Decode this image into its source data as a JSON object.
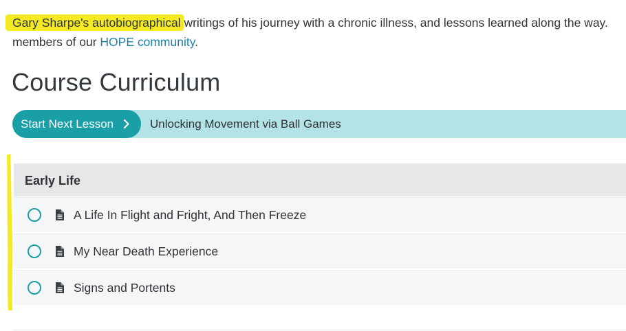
{
  "intro": {
    "highlighted_text": "Gary Sharpe's autobiographical",
    "line1_rest": " writings of his journey with a chronic illness, and lessons learned along the way.",
    "line2_prefix": "members of our ",
    "community_link": "HOPE community",
    "line2_suffix": "."
  },
  "curriculum": {
    "heading": "Course Curriculum",
    "next_lesson_button": "Start Next Lesson",
    "next_lesson_title": "Unlocking Movement via Ball Games"
  },
  "sections": [
    {
      "title": "Early Life",
      "lessons": [
        {
          "title": "A Life In Flight and Fright, And Then Freeze",
          "icon": "document-icon",
          "status": "incomplete"
        },
        {
          "title": "My Near Death Experience",
          "icon": "document-icon",
          "status": "incomplete"
        },
        {
          "title": "Signs and Portents",
          "icon": "document-icon",
          "status": "incomplete"
        }
      ]
    }
  ],
  "colors": {
    "accent": "#1a9fa6",
    "next_bar_bg": "#b3e3e6",
    "highlight": "#f4ea24",
    "link": "#1a82a8",
    "section_header_bg": "#e6e7e8",
    "lesson_bg": "#f5f6f7"
  }
}
